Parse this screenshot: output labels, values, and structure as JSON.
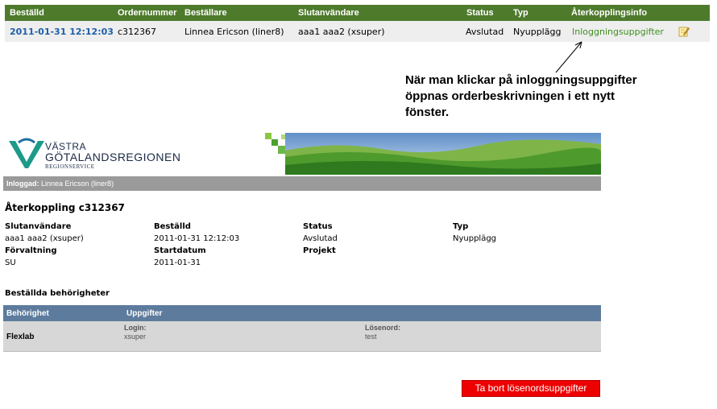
{
  "order_table": {
    "headers": {
      "bestalld": "Beställd",
      "ordernummer": "Ordernummer",
      "bestallare": "Beställare",
      "slutanvandare": "Slutanvändare",
      "status": "Status",
      "typ": "Typ",
      "aterkopplingsinfo": "Återkopplingsinfo"
    },
    "row": {
      "bestalld": "2011-01-31 12:12:03",
      "ordernummer": "c312367",
      "bestallare": "Linnea Ericson (liner8)",
      "slutanvandare": "aaa1 aaa2 (xsuper)",
      "status": "Avslutad",
      "typ": "Nyupplägg",
      "info_link": "Inloggningsuppgifter"
    },
    "header_color": "#4e7a2c",
    "link_color": "#1f5fa8",
    "green_link_color": "#3f8f1e"
  },
  "annotation": {
    "line1": "När man klickar på inloggningsuppgifter",
    "line2": "öppnas orderbeskrivningen i ett nytt",
    "line3": "fönster."
  },
  "vgr": {
    "logo_line1": "VÄSTRA",
    "logo_line2": "GÖTALANDSREGIONEN",
    "logo_line3": "REGIONSERVICE",
    "logo_icon": "vgr-logo-icon",
    "login_label": "Inloggad:",
    "login_user": "Linnea Ericson (liner8)"
  },
  "feedback": {
    "title": "Återkoppling c312367",
    "fields": {
      "slutanvandare_label": "Slutanvändare",
      "slutanvandare_value": "aaa1 aaa2 (xsuper)",
      "bestalld_label": "Beställd",
      "bestalld_value": "2011-01-31 12:12:03",
      "status_label": "Status",
      "status_value": "Avslutad",
      "typ_label": "Typ",
      "typ_value": "Nyupplägg",
      "forvaltning_label": "Förvaltning",
      "forvaltning_value": "SU",
      "startdatum_label": "Startdatum",
      "startdatum_value": "2011-01-31",
      "projekt_label": "Projekt"
    },
    "section_title": "Beställda behörigheter",
    "perm_table": {
      "headers": {
        "behorighet": "Behörighet",
        "uppgifter": "Uppgifter"
      },
      "row": {
        "name": "Flexlab",
        "login_label": "Login:",
        "login_value": "xsuper",
        "password_label": "Lösenord:",
        "password_value": "test"
      }
    },
    "delete_button": "Ta bort lösenordsuppgifter",
    "delete_color": "#ee0000"
  }
}
